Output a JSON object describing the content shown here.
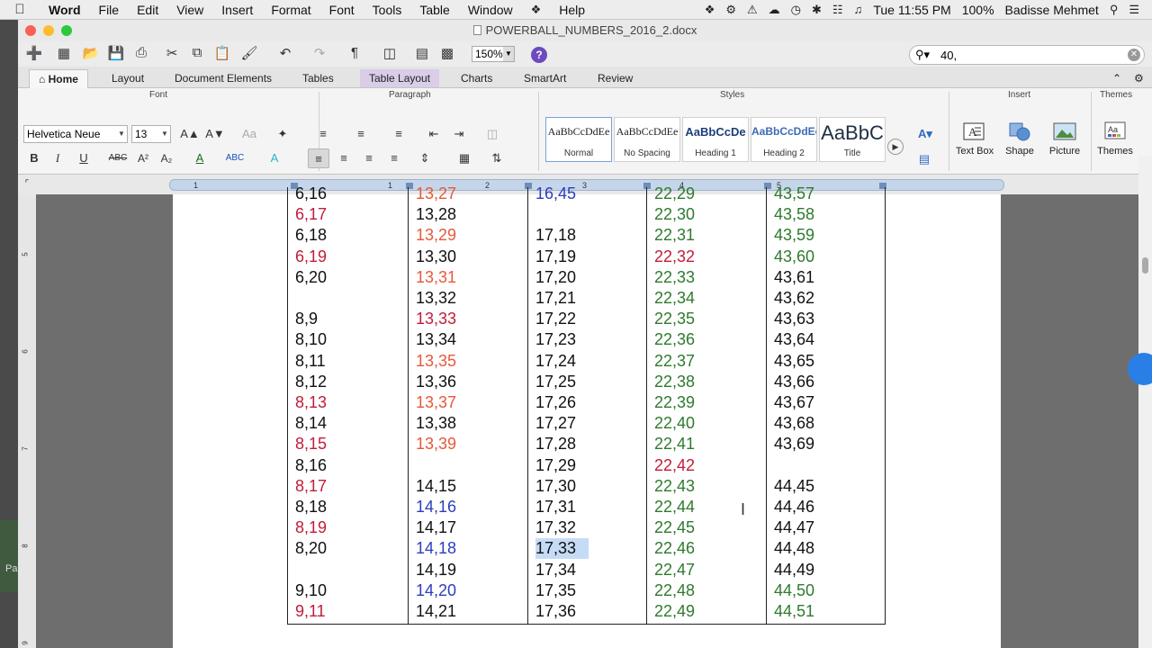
{
  "menubar": {
    "app": "Word",
    "items": [
      "File",
      "Edit",
      "View",
      "Insert",
      "Format",
      "Font",
      "Tools",
      "Table",
      "Window"
    ],
    "help": "Help",
    "clock": "Tue 11:55 PM",
    "battery": "100%",
    "user": "Badisse Mehmet"
  },
  "window": {
    "title": "POWERBALL_NUMBERS_2016_2.docx",
    "zoom": "150%",
    "search_value": "40,"
  },
  "ribbon": {
    "tabs": [
      "Home",
      "Layout",
      "Document Elements",
      "Tables",
      "Table Layout",
      "Charts",
      "SmartArt",
      "Review"
    ],
    "groups": {
      "font": "Font",
      "paragraph": "Paragraph",
      "styles": "Styles",
      "insert": "Insert",
      "themes": "Themes"
    },
    "font_name": "Helvetica Neue",
    "font_size": "13",
    "styles": [
      {
        "sample": "AaBbCcDdEe",
        "label": "Normal"
      },
      {
        "sample": "AaBbCcDdEe",
        "label": "No Spacing"
      },
      {
        "sample": "AaBbCcDe",
        "label": "Heading 1"
      },
      {
        "sample": "AaBbCcDdEe",
        "label": "Heading 2"
      },
      {
        "sample": "AaBbC",
        "label": "Title"
      }
    ],
    "insert_buttons": [
      "Text Box",
      "Shape",
      "Picture"
    ],
    "themes_button": "Themes"
  },
  "ruler": {
    "labels": [
      "1",
      "1",
      "2",
      "3",
      "4",
      "5"
    ]
  },
  "table": {
    "columns": [
      [
        {
          "text": "6,16",
          "color": "black"
        },
        {
          "text": "6,17",
          "color": "red"
        },
        {
          "text": "6,18",
          "color": "black"
        },
        {
          "text": "6,19",
          "color": "red"
        },
        {
          "text": "6,20",
          "color": "black"
        },
        {
          "text": "",
          "color": "black"
        },
        {
          "text": "8,9",
          "color": "black"
        },
        {
          "text": "8,10",
          "color": "black"
        },
        {
          "text": "8,11",
          "color": "black"
        },
        {
          "text": "8,12",
          "color": "black"
        },
        {
          "text": "8,13",
          "color": "red"
        },
        {
          "text": "8,14",
          "color": "black"
        },
        {
          "text": "8,15",
          "color": "red"
        },
        {
          "text": "8,16",
          "color": "black"
        },
        {
          "text": "8,17",
          "color": "red"
        },
        {
          "text": "8,18",
          "color": "black"
        },
        {
          "text": "8,19",
          "color": "red"
        },
        {
          "text": "8,20",
          "color": "black"
        },
        {
          "text": "",
          "color": "black"
        },
        {
          "text": "9,10",
          "color": "black"
        },
        {
          "text": "9,11",
          "color": "red"
        }
      ],
      [
        {
          "text": "13,27",
          "color": "orange"
        },
        {
          "text": "13,28",
          "color": "black"
        },
        {
          "text": "13,29",
          "color": "orange"
        },
        {
          "text": "13,30",
          "color": "black"
        },
        {
          "text": "13,31",
          "color": "orange"
        },
        {
          "text": "13,32",
          "color": "black"
        },
        {
          "text": "13,33",
          "color": "red"
        },
        {
          "text": "13,34",
          "color": "black"
        },
        {
          "text": "13,35",
          "color": "orange"
        },
        {
          "text": "13,36",
          "color": "black"
        },
        {
          "text": "13,37",
          "color": "orange"
        },
        {
          "text": "13,38",
          "color": "black"
        },
        {
          "text": "13,39",
          "color": "orange"
        },
        {
          "text": "",
          "color": "black"
        },
        {
          "text": "14,15",
          "color": "black"
        },
        {
          "text": "14,16",
          "color": "blue"
        },
        {
          "text": "14,17",
          "color": "black"
        },
        {
          "text": "14,18",
          "color": "blue"
        },
        {
          "text": "14,19",
          "color": "black"
        },
        {
          "text": "14,20",
          "color": "blue"
        },
        {
          "text": "14,21",
          "color": "black"
        }
      ],
      [
        {
          "text": "16,45",
          "color": "blue"
        },
        {
          "text": "",
          "color": "black"
        },
        {
          "text": "17,18",
          "color": "black"
        },
        {
          "text": "17,19",
          "color": "black"
        },
        {
          "text": "17,20",
          "color": "black"
        },
        {
          "text": "17,21",
          "color": "black"
        },
        {
          "text": "17,22",
          "color": "black"
        },
        {
          "text": "17,23",
          "color": "black"
        },
        {
          "text": "17,24",
          "color": "black"
        },
        {
          "text": "17,25",
          "color": "black"
        },
        {
          "text": "17,26",
          "color": "black"
        },
        {
          "text": "17,27",
          "color": "black"
        },
        {
          "text": "17,28",
          "color": "black"
        },
        {
          "text": "17,29",
          "color": "black"
        },
        {
          "text": "17,30",
          "color": "black"
        },
        {
          "text": "17,31",
          "color": "black"
        },
        {
          "text": "17,32",
          "color": "black"
        },
        {
          "text": "17,33",
          "color": "black",
          "selected": true
        },
        {
          "text": "17,34",
          "color": "black"
        },
        {
          "text": "17,35",
          "color": "black"
        },
        {
          "text": "17,36",
          "color": "black"
        }
      ],
      [
        {
          "text": "22,29",
          "color": "green"
        },
        {
          "text": "22,30",
          "color": "green"
        },
        {
          "text": "22,31",
          "color": "green"
        },
        {
          "text": "22,32",
          "color": "red"
        },
        {
          "text": "22,33",
          "color": "green"
        },
        {
          "text": "22,34",
          "color": "green"
        },
        {
          "text": "22,35",
          "color": "green"
        },
        {
          "text": "22,36",
          "color": "green"
        },
        {
          "text": "22,37",
          "color": "green"
        },
        {
          "text": "22,38",
          "color": "green"
        },
        {
          "text": "22,39",
          "color": "green"
        },
        {
          "text": "22,40",
          "color": "green"
        },
        {
          "text": "22,41",
          "color": "green"
        },
        {
          "text": "22,42",
          "color": "red"
        },
        {
          "text": "22,43",
          "color": "green"
        },
        {
          "text": "22,44",
          "color": "green"
        },
        {
          "text": "22,45",
          "color": "green"
        },
        {
          "text": "22,46",
          "color": "green"
        },
        {
          "text": "22,47",
          "color": "green"
        },
        {
          "text": "22,48",
          "color": "green"
        },
        {
          "text": "22,49",
          "color": "green"
        }
      ],
      [
        {
          "text": "43,57",
          "color": "green"
        },
        {
          "text": "43,58",
          "color": "green"
        },
        {
          "text": "43,59",
          "color": "green"
        },
        {
          "text": "43,60",
          "color": "green"
        },
        {
          "text": "43,61",
          "color": "black"
        },
        {
          "text": "43,62",
          "color": "black"
        },
        {
          "text": "43,63",
          "color": "black"
        },
        {
          "text": "43,64",
          "color": "black"
        },
        {
          "text": "43,65",
          "color": "black"
        },
        {
          "text": "43,66",
          "color": "black"
        },
        {
          "text": "43,67",
          "color": "black"
        },
        {
          "text": "43,68",
          "color": "black"
        },
        {
          "text": "43,69",
          "color": "black"
        },
        {
          "text": "",
          "color": "black"
        },
        {
          "text": "44,45",
          "color": "black"
        },
        {
          "text": "44,46",
          "color": "black"
        },
        {
          "text": "44,47",
          "color": "black"
        },
        {
          "text": "44,48",
          "color": "black"
        },
        {
          "text": "44,49",
          "color": "black"
        },
        {
          "text": "44,50",
          "color": "green"
        },
        {
          "text": "44,51",
          "color": "green"
        }
      ]
    ]
  },
  "background_snippet": "Pa"
}
